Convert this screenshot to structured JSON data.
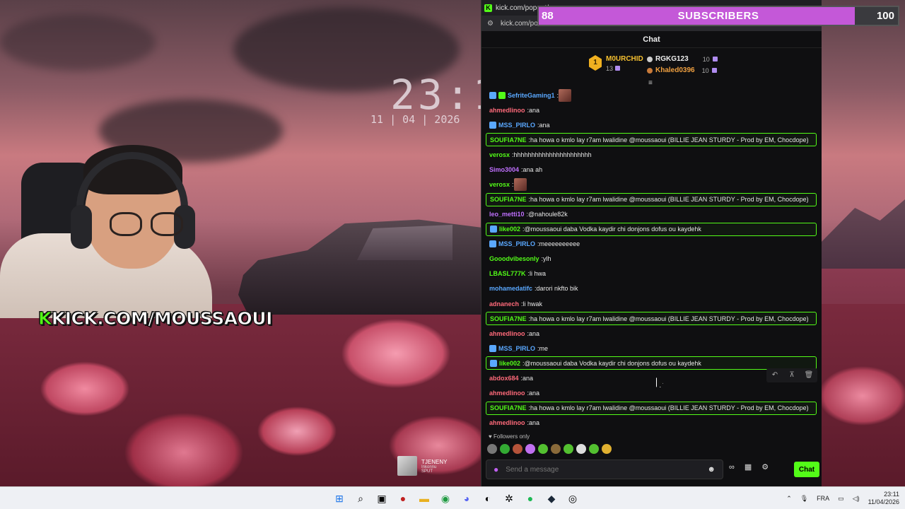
{
  "window": {
    "tab_title": "kick.com/popout/",
    "url": "kick.com/po"
  },
  "overlay": {
    "brand_url_k": "K",
    "brand_url_rest": "KICK.COM/MOUSSAOUI",
    "clock": "23:1",
    "date": "11 | 04 | 2026",
    "music_title": "TJENENY",
    "music_sub1": "Inkonnu",
    "music_sub2": "SPUT"
  },
  "sub_goal": {
    "current": "88",
    "label": "SUBSCRIBERS",
    "target": "100",
    "progress": 0.88
  },
  "chat": {
    "header": "Chat",
    "leaderboard": {
      "top_rank": "1",
      "top_name": "M0URCHID",
      "top_score": "13",
      "second_name": "RGKG123",
      "second_score": "10",
      "third_name": "Khaled0396",
      "third_score": "10"
    },
    "messages": [
      {
        "user": "SefriteGaming1",
        "color": "#5aa8ff",
        "text": "",
        "emote": true,
        "badges": 2,
        "hl": false
      },
      {
        "user": "ahmedlinoo",
        "color": "#ff6a7a",
        "text": "ana",
        "hl": false
      },
      {
        "user": "MSS_PIRLO",
        "color": "#5aa8ff",
        "text": "ana",
        "badges": 1,
        "hl": false
      },
      {
        "user": "SOUFIA7NE",
        "color": "#53fc18",
        "text": "ha howa o kmlo lay r7am lwalidine @moussaoui (BILLIE JEAN STURDY - Prod by EM, Chocdope)",
        "hl": true
      },
      {
        "user": "verosx",
        "color": "#53fc18",
        "text": "hhhhhhhhhhhhhhhhhhhhhh",
        "hl": false
      },
      {
        "user": "Simo3004",
        "color": "#c070ff",
        "text": "ana ah",
        "hl": false
      },
      {
        "user": "verosx",
        "color": "#53fc18",
        "text": "",
        "emote": true,
        "hl": false
      },
      {
        "user": "SOUFIA7NE",
        "color": "#53fc18",
        "text": "ha howa o kmlo lay r7am lwalidine @moussaoui (BILLIE JEAN STURDY - Prod by EM, Chocdope)",
        "hl": true
      },
      {
        "user": "leo_metti10",
        "color": "#c070ff",
        "text": "@nahoule82k",
        "hl": false
      },
      {
        "user": "like002",
        "color": "#53fc18",
        "text": "@moussaoui daba Vodka kaydir chi donjons dofus ou kaydehk",
        "badges": 1,
        "hl": true
      },
      {
        "user": "MSS_PIRLO",
        "color": "#5aa8ff",
        "text": "meeeeeeeeee",
        "badges": 1,
        "hl": false
      },
      {
        "user": "Gooodvibesonly",
        "color": "#53fc18",
        "text": "ylh",
        "hl": false
      },
      {
        "user": "LBASL777K",
        "color": "#53fc18",
        "text": "li hwa",
        "hl": false
      },
      {
        "user": "mohamedatifc",
        "color": "#5aa8ff",
        "text": "darori nkfto bik",
        "hl": false
      },
      {
        "user": "adnanech",
        "color": "#ff6a7a",
        "text": "li hwak",
        "hl": false
      },
      {
        "user": "SOUFIA7NE",
        "color": "#53fc18",
        "text": "ha howa o kmlo lay r7am lwalidine @moussaoui (BILLIE JEAN STURDY - Prod by EM, Chocdope)",
        "hl": true
      },
      {
        "user": "ahmedlinoo",
        "color": "#ff6a7a",
        "text": "ana",
        "hl": false
      },
      {
        "user": "MSS_PIRLO",
        "color": "#5aa8ff",
        "text": "me",
        "badges": 1,
        "hl": false
      },
      {
        "user": "like002",
        "color": "#53fc18",
        "text": "@moussaoui daba Vodka kaydir chi donjons dofus ou kaydehk",
        "badges": 1,
        "hl": true
      },
      {
        "user": "abdox684",
        "color": "#ff6a7a",
        "text": "ana",
        "hl": false
      },
      {
        "user": "ahmedlinoo",
        "color": "#ff6a7a",
        "text": "ana",
        "hl": false
      },
      {
        "user": "SOUFIA7NE",
        "color": "#53fc18",
        "text": "ha howa o kmlo lay r7am lwalidine @moussaoui (BILLIE JEAN STURDY - Prod by EM, Chocdope)",
        "hl": true
      },
      {
        "user": "ahmedlinoo",
        "color": "#ff6a7a",
        "text": "ana",
        "hl": false
      }
    ],
    "followers_only": "Followers only",
    "input_placeholder": "Send a message",
    "send_label": "Chat"
  },
  "taskbar": {
    "time": "23:11",
    "date": "11/04/2026",
    "lang": "FRA"
  },
  "colors": {
    "kick_green": "#53fc18",
    "goal_purple": "#c458d8"
  }
}
